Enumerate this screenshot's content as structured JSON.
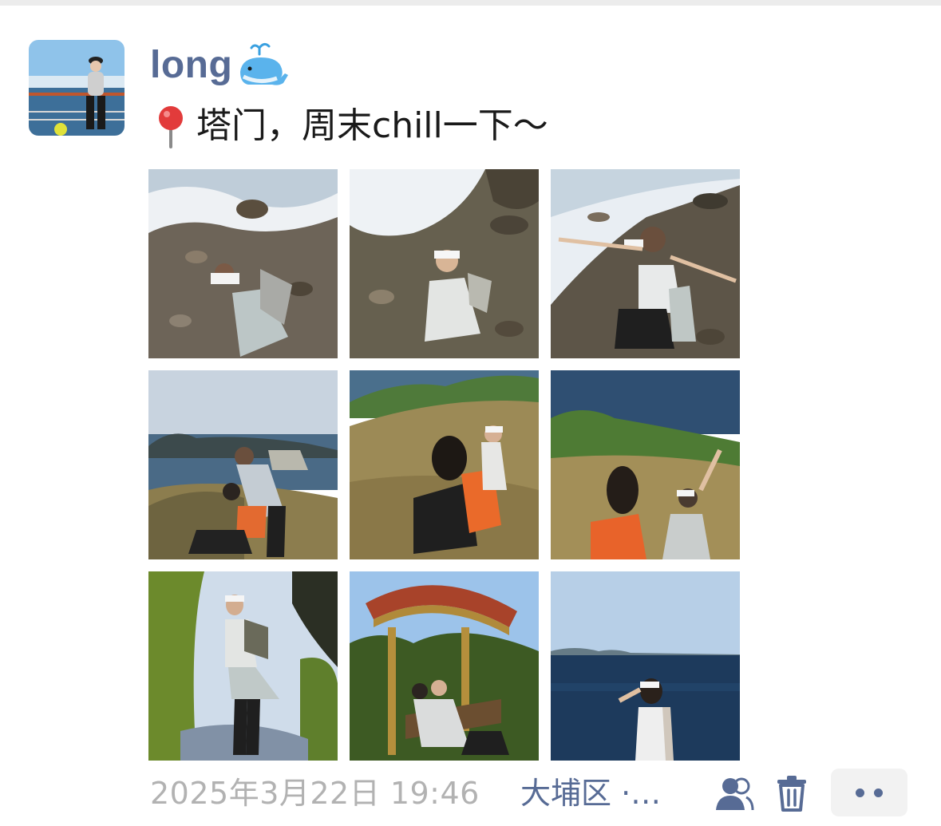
{
  "post": {
    "username": "long",
    "username_emoji_icon": "spouting-whale-icon",
    "location_pin_icon": "round-pushpin-icon",
    "text": "塔门，周末chill一下～",
    "photos": [
      {
        "scene": "rocky-shore-crouching"
      },
      {
        "scene": "rocky-shore-smiling"
      },
      {
        "scene": "rocky-shore-arms-out"
      },
      {
        "scene": "hill-bay-two-hikers"
      },
      {
        "scene": "grass-slope-resting"
      },
      {
        "scene": "grass-sea-waving"
      },
      {
        "scene": "trail-standing"
      },
      {
        "scene": "pavilion-bench"
      },
      {
        "scene": "sea-shading-eyes"
      }
    ],
    "timestamp": "2025年3月22日 19:46",
    "location": "大埔区 ·…",
    "actions": {
      "visibility_icon": "people-icon",
      "delete_icon": "trash-icon",
      "more_icon": "more-dots-icon"
    }
  },
  "colors": {
    "name_link": "#576b95",
    "timestamp": "#b2b2b2",
    "body_text": "#1a1a1a",
    "divider": "#ececec"
  }
}
